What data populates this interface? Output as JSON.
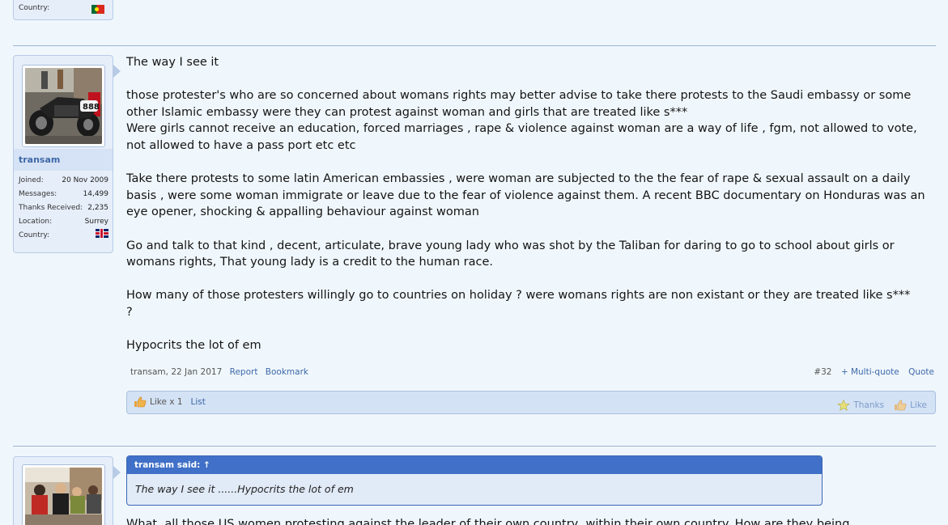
{
  "prev_post": {
    "country_label": "Country:",
    "country_flag": "flag-portugal"
  },
  "post32": {
    "username": "transam",
    "stats": [
      {
        "label": "Joined:",
        "value": "20 Nov 2009"
      },
      {
        "label": "Messages:",
        "value": "14,499"
      },
      {
        "label": "Thanks Received:",
        "value": "2,235"
      },
      {
        "label": "Location:",
        "value": "Surrey"
      },
      {
        "label": "Country:",
        "value": ""
      }
    ],
    "country_flag": "flag-uk",
    "paragraphs": [
      "The way I see it",
      "those protester's who are so concerned about womans rights may better advise to take there protests to the Saudi embassy or some other Islamic embassy were they can protest against woman and girls that are treated like s***\nWere girls cannot receive an education, forced marriages , rape & violence against woman are a way of life , fgm, not allowed to vote, not allowed to have a pass port etc etc",
      "Take there protests to some latin American embassies , were woman are subjected to the the fear of rape & sexual assault on a daily basis , were some woman immigrate or leave due to the fear of violence against them. A recent BBC documentary on Honduras was an eye opener, shocking & appalling behaviour against woman",
      "Go and talk to that kind , decent, articulate, brave young lady who was shot by the Taliban for daring to go to school about girls or womans rights, That young lady is a credit to the human race.",
      "How many of those protesters willingly go to countries on holiday ? were womans rights are non existant or they are treated like s***\n?",
      "Hypocrits the lot of em"
    ],
    "footer": {
      "author_date": "transam, 22 Jan 2017",
      "report": "Report",
      "bookmark": "Bookmark",
      "post_number": "#32",
      "multi_quote": "+ Multi-quote",
      "quote": "Quote"
    },
    "likes": {
      "like_count": "Like x 1",
      "list": "List",
      "thanks": "Thanks",
      "like": "Like"
    }
  },
  "post33": {
    "quote_header": "transam said: ↑",
    "quote_body": "The way I see it ......Hypocrits the lot of em",
    "cut_text": "What, all those US women protesting against the leader of their own country, within their own country. How are they being"
  }
}
